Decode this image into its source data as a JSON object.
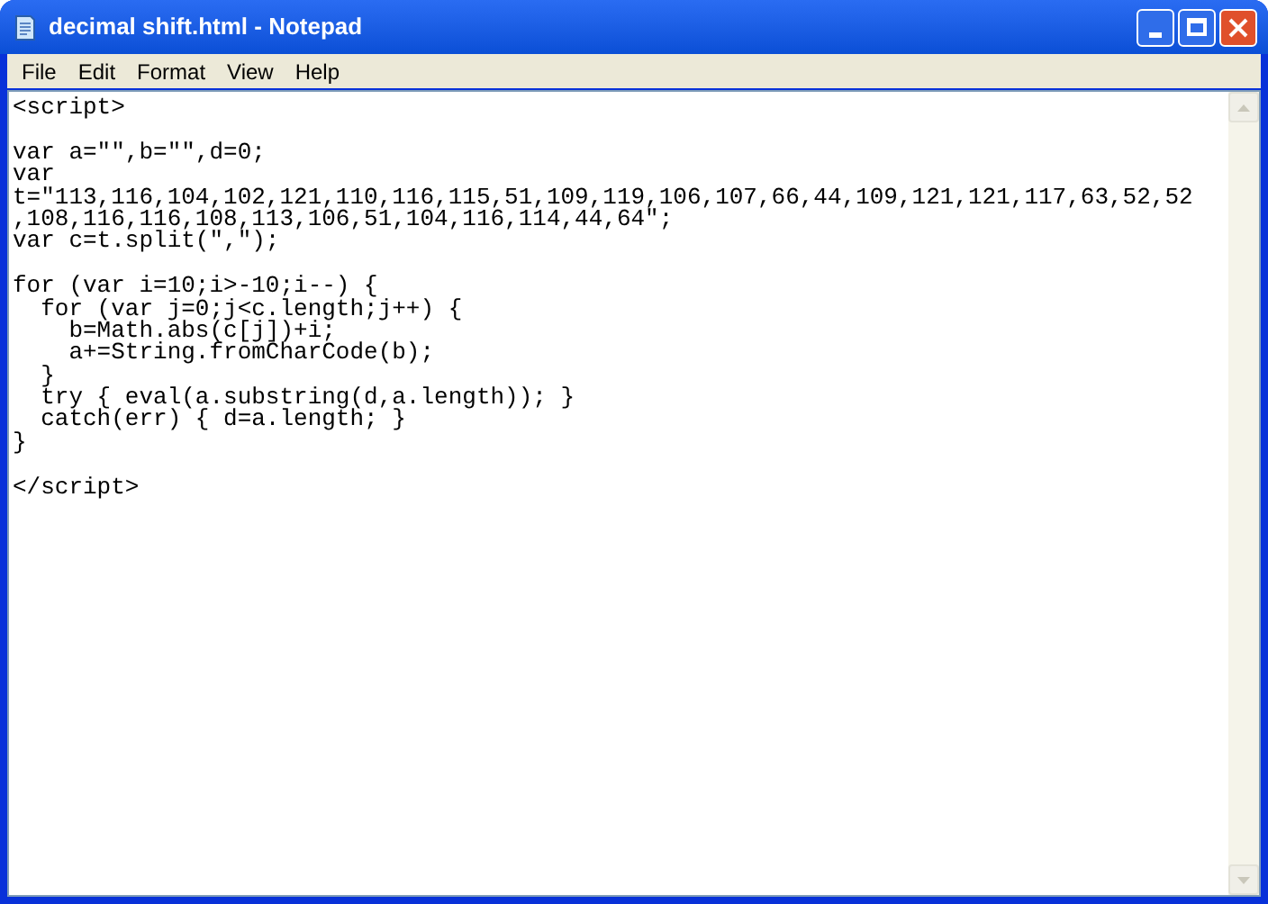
{
  "window": {
    "title": "decimal shift.html - Notepad"
  },
  "menu": [
    "File",
    "Edit",
    "Format",
    "View",
    "Help"
  ],
  "editor": {
    "blocks": [
      [
        "<script>"
      ],
      [
        "var a=\"\",b=\"\",d=0;",
        "var",
        "t=\"113,116,104,102,121,110,116,115,51,109,119,106,107,66,44,109,121,121,117,63,52,52",
        ",108,116,116,108,113,106,51,104,116,114,44,64\";",
        "var c=t.split(\",\");"
      ],
      [
        "for (var i=10;i>-10;i--) {",
        "  for (var j=0;j<c.length;j++) {",
        "    b=Math.abs(c[j])+i;",
        "    a+=String.fromCharCode(b);",
        "  }",
        "  try { eval(a.substring(d,a.length)); }",
        "  catch(err) { d=a.length; }",
        "}"
      ],
      [
        "</script>"
      ]
    ]
  }
}
